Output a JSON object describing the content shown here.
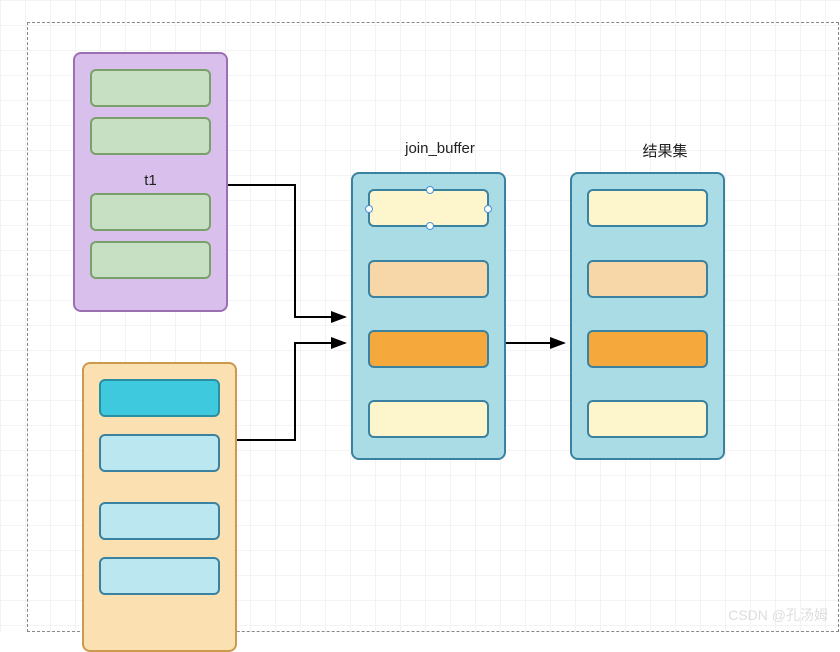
{
  "labels": {
    "t1": "t1",
    "join_buffer": "join_buffer",
    "result_set": "结果集",
    "watermark": "CSDN @孔汤姆"
  },
  "boxes": {
    "t1": {
      "fill": "#d9bfeb",
      "border": "#9c6fb3",
      "rows": [
        "#c7e0c4",
        "#c7e0c4",
        "#c7e0c4",
        "#c7e0c4"
      ]
    },
    "t2": {
      "fill": "#fbe0b2",
      "border": "#cc9a4b",
      "rows": [
        "#3fc9de",
        "#bbe7f1",
        "#bbe7f1",
        "#bbe7f1"
      ]
    },
    "join_buffer": {
      "fill": "#a9dce4",
      "border": "#3b82a0",
      "rows": [
        "#fdf5cb",
        "#f7d6a8",
        "#f5a93c",
        "#fdf5cb"
      ]
    },
    "result_set": {
      "fill": "#a9dce4",
      "border": "#3b82a0",
      "rows": [
        "#fdf5cb",
        "#f7d6a8",
        "#f5a93c",
        "#fdf5cb"
      ]
    }
  },
  "chart_data": {
    "type": "diagram",
    "nodes": [
      {
        "id": "t1",
        "label": "t1",
        "rows": 4
      },
      {
        "id": "t2",
        "label": "",
        "rows": 4
      },
      {
        "id": "join_buffer",
        "label": "join_buffer",
        "rows": 4
      },
      {
        "id": "result_set",
        "label": "结果集",
        "rows": 4
      }
    ],
    "edges": [
      {
        "from": "t1",
        "to": "join_buffer"
      },
      {
        "from": "t2",
        "to": "join_buffer"
      },
      {
        "from": "join_buffer",
        "to": "result_set"
      }
    ],
    "annotations": {
      "selected_row": {
        "box": "join_buffer",
        "index": 0
      }
    }
  }
}
